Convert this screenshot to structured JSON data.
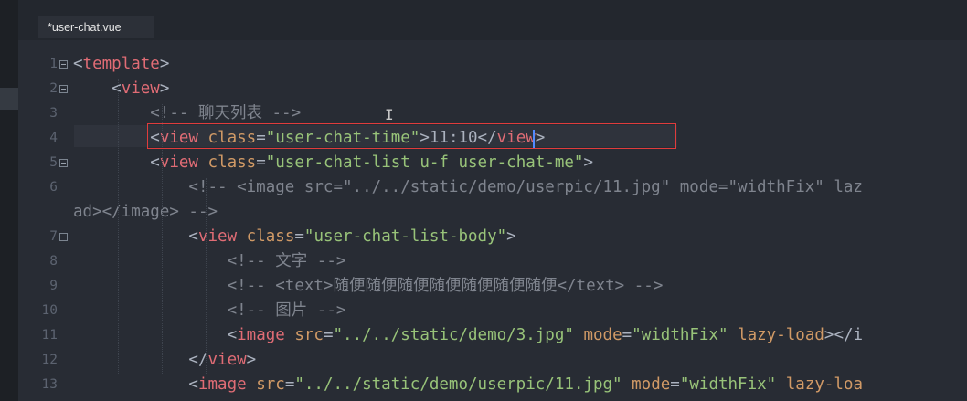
{
  "tab": {
    "title": "*user-chat.vue"
  },
  "lines": [
    {
      "num": "1",
      "tokens": [
        [
          "p",
          "<"
        ],
        [
          "t",
          "template"
        ],
        [
          "p",
          ">"
        ]
      ]
    },
    {
      "num": "2",
      "tokens": [
        [
          "p",
          "    <"
        ],
        [
          "t",
          "view"
        ],
        [
          "p",
          ">"
        ]
      ]
    },
    {
      "num": "3",
      "tokens": [
        [
          "c",
          "        <!-- 聊天列表 -->"
        ]
      ]
    },
    {
      "num": "4",
      "tokens": [
        [
          "p",
          "        <"
        ],
        [
          "t",
          "view"
        ],
        [
          "p",
          " "
        ],
        [
          "a",
          "class"
        ],
        [
          "p",
          "="
        ],
        [
          "s",
          "\"user-chat-time\""
        ],
        [
          "p",
          ">11:10</"
        ],
        [
          "t",
          "view"
        ],
        [
          "p",
          ">"
        ]
      ]
    },
    {
      "num": "5",
      "tokens": [
        [
          "p",
          "        <"
        ],
        [
          "t",
          "view"
        ],
        [
          "p",
          " "
        ],
        [
          "a",
          "class"
        ],
        [
          "p",
          "="
        ],
        [
          "s",
          "\"user-chat-list u-f user-chat-me\""
        ],
        [
          "p",
          ">"
        ]
      ]
    },
    {
      "num": "6",
      "tokens": [
        [
          "c",
          "            <!-- <image src=\"../../static/demo/userpic/11.jpg\" mode=\"widthFix\" laz"
        ]
      ]
    },
    {
      "num": "",
      "tokens": [
        [
          "c",
          "ad></image> -->"
        ]
      ]
    },
    {
      "num": "7",
      "tokens": [
        [
          "p",
          "            <"
        ],
        [
          "t",
          "view"
        ],
        [
          "p",
          " "
        ],
        [
          "a",
          "class"
        ],
        [
          "p",
          "="
        ],
        [
          "s",
          "\"user-chat-list-body\""
        ],
        [
          "p",
          ">"
        ]
      ]
    },
    {
      "num": "8",
      "tokens": [
        [
          "c",
          "                <!-- 文字 -->"
        ]
      ]
    },
    {
      "num": "9",
      "tokens": [
        [
          "c",
          "                <!-- <text>随便随便随便随便随便随便随便</text> -->"
        ]
      ]
    },
    {
      "num": "10",
      "tokens": [
        [
          "c",
          "                <!-- 图片 -->"
        ]
      ]
    },
    {
      "num": "11",
      "tokens": [
        [
          "p",
          "                <"
        ],
        [
          "t",
          "image"
        ],
        [
          "p",
          " "
        ],
        [
          "a",
          "src"
        ],
        [
          "p",
          "="
        ],
        [
          "s",
          "\"../../static/demo/3.jpg\""
        ],
        [
          "p",
          " "
        ],
        [
          "a",
          "mode"
        ],
        [
          "p",
          "="
        ],
        [
          "s",
          "\"widthFix\""
        ],
        [
          "p",
          " "
        ],
        [
          "a",
          "lazy-load"
        ],
        [
          "p",
          "></i"
        ]
      ]
    },
    {
      "num": "12",
      "tokens": [
        [
          "p",
          "            </"
        ],
        [
          "t",
          "view"
        ],
        [
          "p",
          ">"
        ]
      ]
    },
    {
      "num": "13",
      "tokens": [
        [
          "p",
          "            <"
        ],
        [
          "t",
          "image"
        ],
        [
          "p",
          " "
        ],
        [
          "a",
          "src"
        ],
        [
          "p",
          "="
        ],
        [
          "s",
          "\"../../static/demo/userpic/11.jpg\""
        ],
        [
          "p",
          " "
        ],
        [
          "a",
          "mode"
        ],
        [
          "p",
          "="
        ],
        [
          "s",
          "\"widthFix\""
        ],
        [
          "p",
          " "
        ],
        [
          "a",
          "lazy-loa"
        ]
      ]
    }
  ],
  "folds": [
    "1",
    "2",
    "5",
    "7"
  ],
  "colors": {
    "background": "#282c34",
    "tag": "#e06c75",
    "attribute": "#d19a66",
    "string": "#98c379",
    "comment": "#7f848e",
    "highlight_box": "#e03c3c"
  },
  "icons": {
    "fold": "fold-collapse-icon",
    "text_cursor": "i-beam-cursor-icon"
  }
}
